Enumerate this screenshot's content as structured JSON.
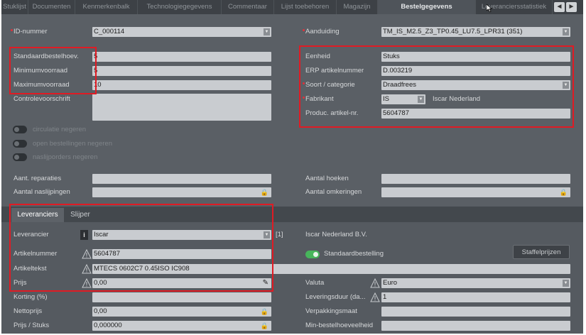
{
  "tabs": [
    "Stuklijst",
    "Documenten",
    "Kenmerkenbalk",
    "Technologiegegevens",
    "Commentaar",
    "Lijst toebehoren",
    "Magazijn",
    "Bestelgegevens",
    "Leveranciersstatistiek"
  ],
  "nav": {
    "prev": "◄",
    "next": "►"
  },
  "form": {
    "id_label": "ID-nummer",
    "id_value": "C_000114",
    "aanduiding_label": "Aanduiding",
    "aanduiding_value": "TM_IS_M2.5_Z3_TP0.45_LU7.5_LPR31 (351)",
    "std_label": "Standaardbestelhoev.",
    "std_value": "5",
    "min_label": "Minimumvoorraad",
    "min_value": "5",
    "max_label": "Maximumvoorraad",
    "max_value": "10",
    "ctrl_label": "Controlevoorschrift",
    "ctrl_value": "",
    "eenheid_label": "Eenheid",
    "eenheid_value": "Stuks",
    "erp_label": "ERP artikelnummer",
    "erp_value": "D.003219",
    "soort_label": "Soort / categorie",
    "soort_value": "Draadfrees",
    "fabrikant_label": "Fabrikant",
    "fabrikant_code": "IS",
    "fabrikant_name": "Iscar Nederland",
    "produc_label": "Produc. artikel-nr.",
    "produc_value": "5604787",
    "toggle1": "circulatie negeren",
    "toggle2": "open bestellingen negeren",
    "toggle3": "naslijporders negeren",
    "reparaties_label": "Aant. reparaties",
    "reparaties_value": "",
    "naslijpingen_label": "Aantal naslijpingen",
    "naslijpingen_value": "",
    "hoeken_label": "Aantal hoeken",
    "hoeken_value": "",
    "omkeringen_label": "Aantal omkeringen",
    "omkeringen_value": ""
  },
  "subtabs": [
    "Leveranciers",
    "Slijper"
  ],
  "supplier": {
    "leverancier_label": "Leverancier",
    "leverancier_value": "Iscar",
    "leverancier_count": "[1]",
    "supplier_name": "Iscar Nederland B.V.",
    "artikelnummer_label": "Artikelnummer",
    "artikelnummer_value": "5604787",
    "standaard_label": "Standaardbestelling",
    "staffel_button": "Staffelprijzen",
    "artikeltekst_label": "Artikeltekst",
    "artikeltekst_value": "MTECS 0602C7 0.45ISO IC908",
    "prijs_label": "Prijs",
    "prijs_value": "0,00",
    "valuta_label": "Valuta",
    "valuta_value": "Euro",
    "korting_label": "Korting (%)",
    "korting_value": "",
    "levering_label": "Leveringsduur (da...",
    "levering_value": "1",
    "netto_label": "Nettoprijs",
    "netto_value": "0,00",
    "verpak_label": "Verpakkingsmaat",
    "verpak_value": "",
    "prijsstuk_label": "Prijs / Stuks",
    "prijsstuk_value": "0,000000",
    "minbestel_label": "Min-bestelhoeveelheid",
    "minbestel_value": ""
  },
  "colors": {
    "highlight": "#e01b24",
    "toggle_on": "#47b55b",
    "required": "#e0313a"
  }
}
